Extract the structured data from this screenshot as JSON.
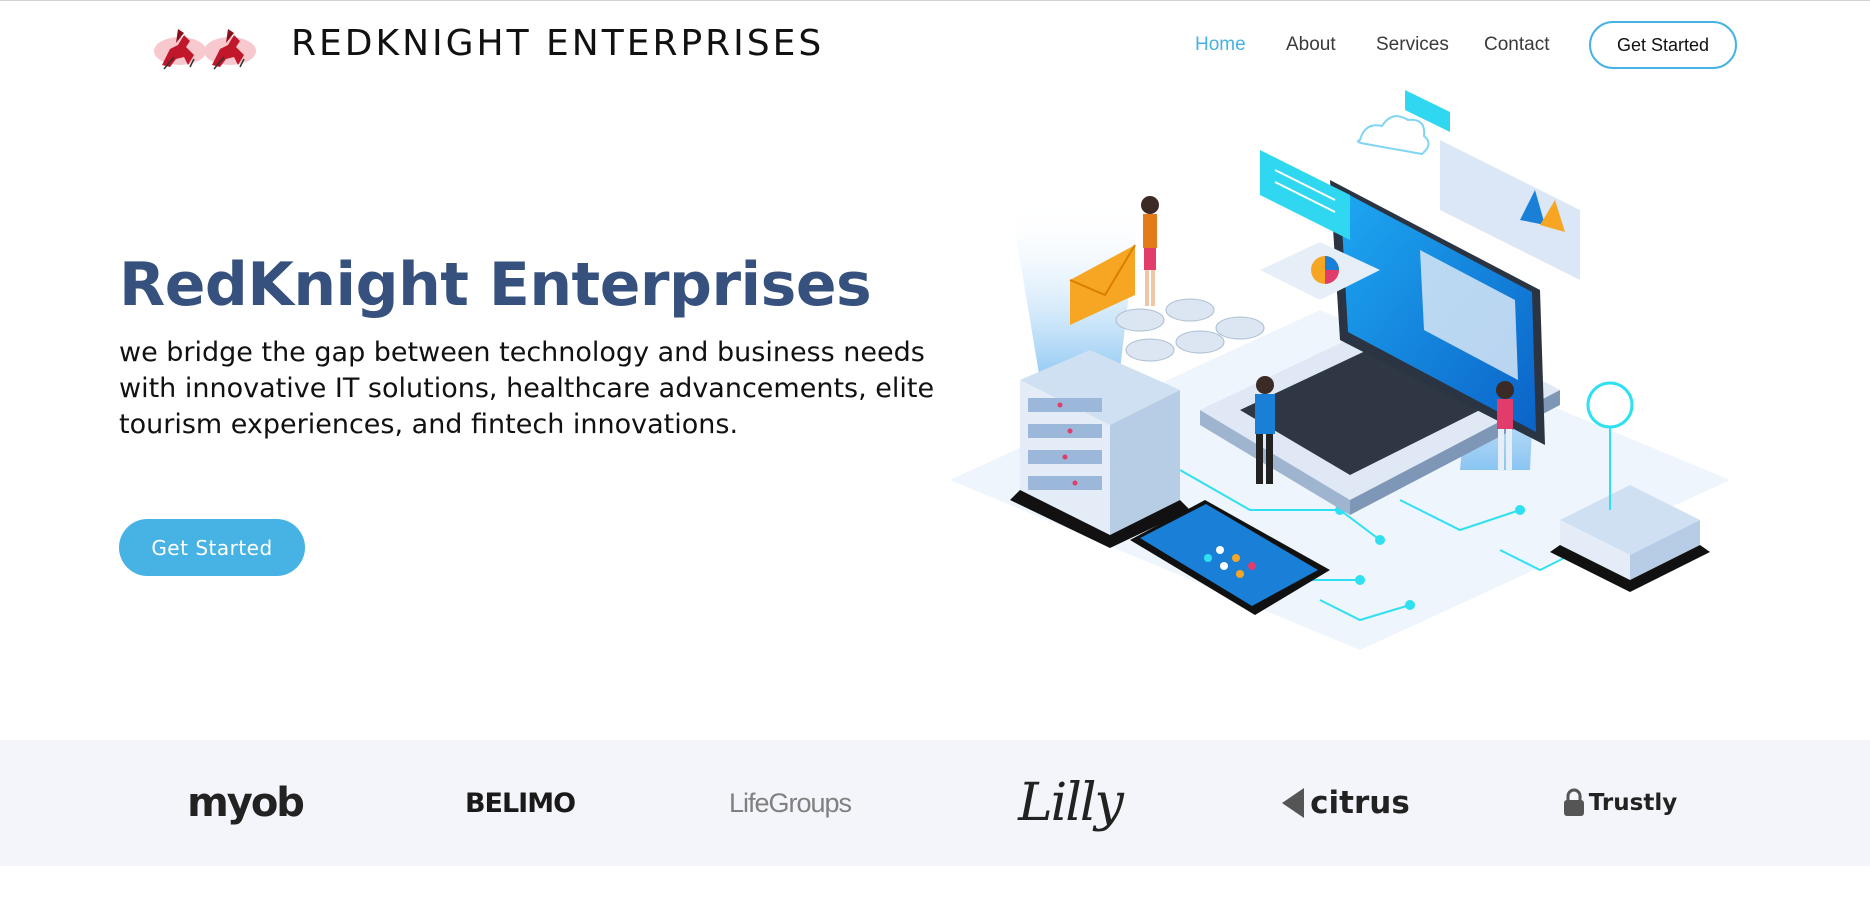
{
  "header": {
    "brand": "REDKNIGHT ENTERPRISES",
    "logo_icon": "horse-riders-logo",
    "nav": [
      {
        "label": "Home",
        "active": true
      },
      {
        "label": "About",
        "active": false
      },
      {
        "label": "Services",
        "active": false
      },
      {
        "label": "Contact",
        "active": false
      }
    ],
    "cta": "Get Started"
  },
  "hero": {
    "title": "RedKnight Enterprises",
    "text": "we bridge the gap between technology and business needs with innovative IT solutions, healthcare advancements, elite tourism experiences, and fintech innovations.",
    "cta": "Get Started",
    "illustration": "isometric-laptop-network-illustration"
  },
  "clients": [
    "myob",
    "BELIMO",
    "LifeGroups",
    "Lilly",
    "citrus",
    "Trustly"
  ],
  "colors": {
    "accent": "#47b2e4",
    "title": "#37517e",
    "clients_bg": "#f3f5fa"
  }
}
